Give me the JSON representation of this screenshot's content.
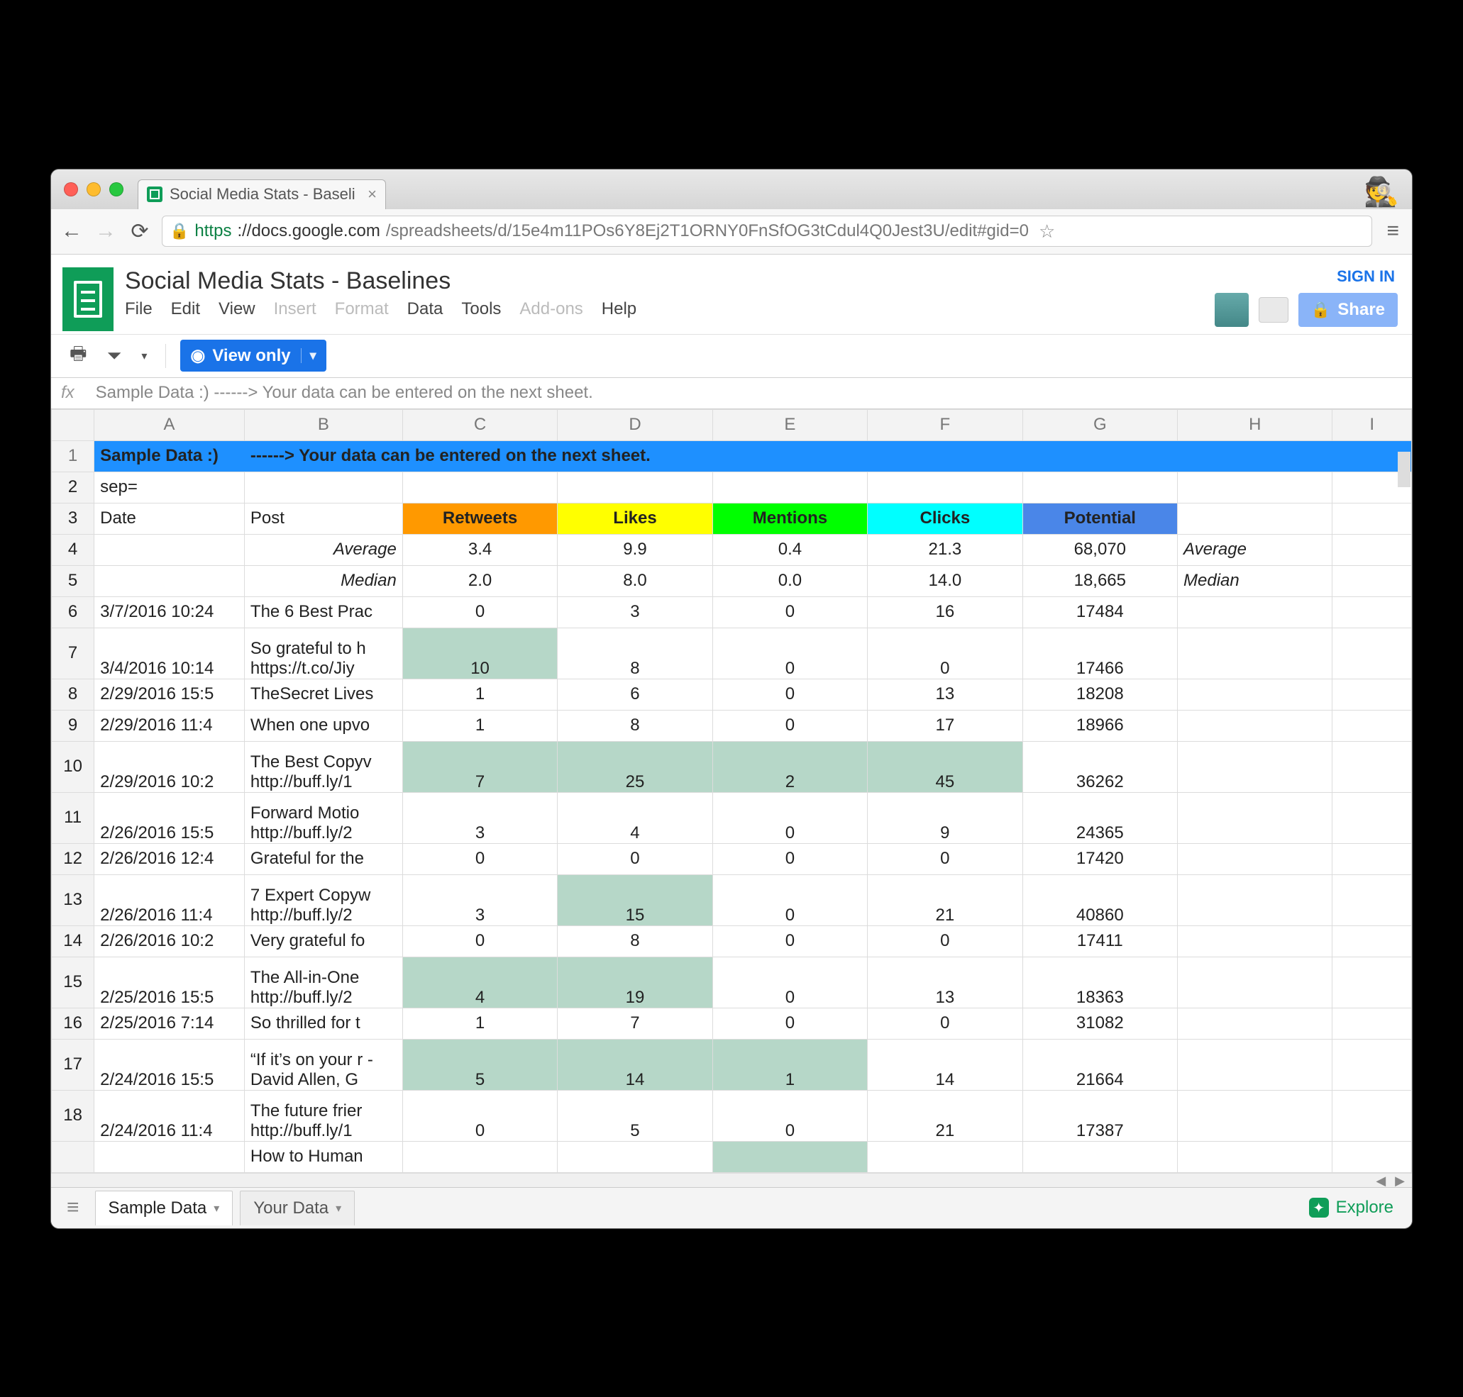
{
  "browser": {
    "tab_title": "Social Media Stats - Baseli",
    "url_scheme": "https",
    "url_host": "://docs.google.com",
    "url_path": "/spreadsheets/d/15e4m11POs6Y8Ej2T1ORNY0FnSfOG3tCdul4Q0Jest3U/edit#gid=0"
  },
  "doc": {
    "title": "Social Media Stats - Baselines",
    "menus": [
      "File",
      "Edit",
      "View",
      "Insert",
      "Format",
      "Data",
      "Tools",
      "Add-ons",
      "Help"
    ],
    "menus_disabled": [
      "Insert",
      "Format",
      "Add-ons"
    ],
    "signin": "SIGN IN",
    "share": "Share",
    "view_only": "View only"
  },
  "formula_bar": "Sample Data :)  ------> Your data can be entered on the next sheet.",
  "columns": [
    "A",
    "B",
    "C",
    "D",
    "E",
    "F",
    "G",
    "H",
    "I"
  ],
  "banner": {
    "a": "Sample Data :)",
    "b": "------> Your data can be entered on the next sheet."
  },
  "row2_a": "sep=",
  "headers": {
    "date": "Date",
    "post": "Post",
    "retweets": "Retweets",
    "likes": "Likes",
    "mentions": "Mentions",
    "clicks": "Clicks",
    "potential": "Potential"
  },
  "stats": {
    "average_label": "Average",
    "median_label": "Median",
    "average": {
      "retweets": "3.4",
      "likes": "9.9",
      "mentions": "0.4",
      "clicks": "21.3",
      "potential": "68,070"
    },
    "median": {
      "retweets": "2.0",
      "likes": "8.0",
      "mentions": "0.0",
      "clicks": "14.0",
      "potential": "18,665"
    }
  },
  "rows": [
    {
      "n": "6",
      "tall": false,
      "date": "3/7/2016 10:24",
      "post": "The 6 Best Prac",
      "rt": "0",
      "lk": "3",
      "mn": "0",
      "ck": "16",
      "pt": "17484",
      "hi": []
    },
    {
      "n": "7",
      "tall": true,
      "date": "3/4/2016 10:14",
      "post": "So grateful to h https://t.co/Jiy",
      "rt": "10",
      "lk": "8",
      "mn": "0",
      "ck": "0",
      "pt": "17466",
      "hi": [
        "rt"
      ]
    },
    {
      "n": "8",
      "tall": false,
      "date": "2/29/2016 15:5",
      "post": "TheSecret Lives",
      "rt": "1",
      "lk": "6",
      "mn": "0",
      "ck": "13",
      "pt": "18208",
      "hi": []
    },
    {
      "n": "9",
      "tall": false,
      "date": "2/29/2016 11:4",
      "post": "When one upvo",
      "rt": "1",
      "lk": "8",
      "mn": "0",
      "ck": "17",
      "pt": "18966",
      "hi": []
    },
    {
      "n": "10",
      "tall": true,
      "date": "2/29/2016 10:2",
      "post": "The Best Copyv http://buff.ly/1",
      "rt": "7",
      "lk": "25",
      "mn": "2",
      "ck": "45",
      "pt": "36262",
      "hi": [
        "rt",
        "lk",
        "mn",
        "ck"
      ]
    },
    {
      "n": "11",
      "tall": true,
      "date": "2/26/2016 15:5",
      "post": "Forward Motio http://buff.ly/2",
      "rt": "3",
      "lk": "4",
      "mn": "0",
      "ck": "9",
      "pt": "24365",
      "hi": []
    },
    {
      "n": "12",
      "tall": false,
      "date": "2/26/2016 12:4",
      "post": "Grateful for the",
      "rt": "0",
      "lk": "0",
      "mn": "0",
      "ck": "0",
      "pt": "17420",
      "hi": []
    },
    {
      "n": "13",
      "tall": true,
      "date": "2/26/2016 11:4",
      "post": "7 Expert Copyw http://buff.ly/2",
      "rt": "3",
      "lk": "15",
      "mn": "0",
      "ck": "21",
      "pt": "40860",
      "hi": [
        "lk"
      ]
    },
    {
      "n": "14",
      "tall": false,
      "date": "2/26/2016 10:2",
      "post": "Very grateful fo",
      "rt": "0",
      "lk": "8",
      "mn": "0",
      "ck": "0",
      "pt": "17411",
      "hi": []
    },
    {
      "n": "15",
      "tall": true,
      "date": "2/25/2016 15:5",
      "post": "The All-in-One http://buff.ly/2",
      "rt": "4",
      "lk": "19",
      "mn": "0",
      "ck": "13",
      "pt": "18363",
      "hi": [
        "rt",
        "lk"
      ]
    },
    {
      "n": "16",
      "tall": false,
      "date": "2/25/2016 7:14",
      "post": "So thrilled for t",
      "rt": "1",
      "lk": "7",
      "mn": "0",
      "ck": "0",
      "pt": "31082",
      "hi": []
    },
    {
      "n": "17",
      "tall": true,
      "date": "2/24/2016 15:5",
      "post": "“If it’s on your r - David Allen, G",
      "rt": "5",
      "lk": "14",
      "mn": "1",
      "ck": "14",
      "pt": "21664",
      "hi": [
        "rt",
        "lk",
        "mn"
      ]
    },
    {
      "n": "18",
      "tall": true,
      "date": "2/24/2016 11:4",
      "post": "The future frier http://buff.ly/1",
      "rt": "0",
      "lk": "5",
      "mn": "0",
      "ck": "21",
      "pt": "17387",
      "hi": []
    }
  ],
  "partial_row": {
    "post": "How to Human",
    "hi": [
      "mn"
    ]
  },
  "sheets": {
    "tab1": "Sample Data",
    "tab2": "Your Data"
  },
  "explore": "Explore"
}
